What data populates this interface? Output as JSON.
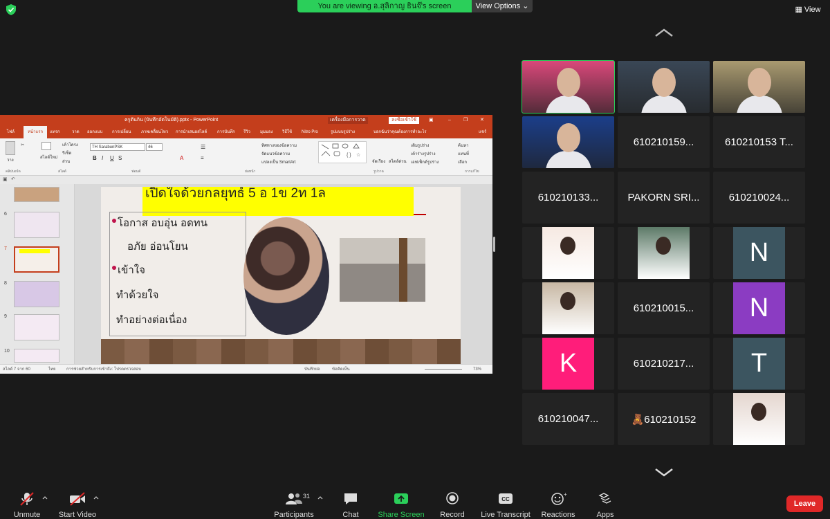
{
  "top_bar": {
    "banner_text": "You are viewing อ.สุลิกาญ ธินจ๊'s screen",
    "view_options_label": "View Options",
    "view_label": "View"
  },
  "ppt": {
    "window_title": "ครูต้นกิน (บันทึกอัตโนมัติ).pptx  -  PowerPoint",
    "tools_tag": "เครื่องมือการวาด",
    "login_label": "ลงชื่อเข้าใช้",
    "tabs": [
      "ไฟล์",
      "หน้าแรก",
      "แทรก",
      "วาด",
      "ออกแบบ",
      "การเปลี่ยน",
      "ภาพเคลื่อนไหว",
      "การนำเสนอสไลด์",
      "การบันทึก",
      "รีวิว",
      "มุมมอง",
      "วิธีใช้",
      "Nitro Pro",
      "รูปแบบรูปร่าง",
      "บอกฉันว่าคุณต้องการทำอะไร",
      "แชร์"
    ],
    "font_name": "TH SarabunPSK",
    "font_size": "46",
    "ribbon_groups": [
      "คลิปบอร์ด",
      "สไลด์",
      "ฟอนต์",
      "ย่อหน้า",
      "รูปวาด",
      "การแก้ไข"
    ],
    "ribbon_items": {
      "paste": "วาง",
      "new_slide": "สไลด์ใหม่",
      "layout": "เค้าโครง",
      "reset": "รีเซ็ต",
      "section": "ส่วน",
      "text_direction": "ทิศทางของข้อความ",
      "align_text": "จัดแนวข้อความ",
      "smartart": "แปลงเป็น SmartArt",
      "arrange": "จัดเรียง",
      "quick_styles": "สไตล์ด่วน",
      "shape_fill": "เติมรูปร่าง",
      "shape_outline": "เค้าร่างรูปร่าง",
      "shape_effects": "เอฟเฟ็กต์รูปร่าง",
      "find": "ค้นหา",
      "replace": "แทนที่",
      "select": "เลือก"
    },
    "thumb_numbers": [
      "6",
      "7",
      "8",
      "9",
      "10"
    ],
    "slide": {
      "title": "เปิดใจด้วยกลยุทธ์  5 อ 1ข 2ท 1ล",
      "lines": [
        "โอกาส  อบอุ่น  อดทน",
        "อภัย  อ่อนโยน",
        "เข้าใจ",
        "ทำด้วยใจ",
        "ทำอย่างต่อเนื่อง"
      ]
    },
    "status": {
      "slide_count": "สไลด์ 7 จาก 60",
      "language": "ไทย",
      "accessibility": "การช่วยสำหรับการเข้าถึง: โปรดตรวจสอบ",
      "notes": "บันทึกย่อ",
      "comments": "ข้อคิดเห็น",
      "zoom": "73%"
    }
  },
  "gallery": {
    "participants": [
      {
        "name": "",
        "kind": "video",
        "active": true,
        "bg": "#d9487a"
      },
      {
        "name": "",
        "kind": "video",
        "bg": "#3a4756"
      },
      {
        "name": "",
        "kind": "video",
        "bg": "#a99a70"
      },
      {
        "name": "",
        "kind": "video",
        "bg": "#1b3e8a"
      },
      {
        "name": "610210159...",
        "kind": "name"
      },
      {
        "name": "610210153 T...",
        "kind": "name"
      },
      {
        "name": "610210133...",
        "kind": "name"
      },
      {
        "name": "PAKORN SRI...",
        "kind": "name"
      },
      {
        "name": "610210024...",
        "kind": "name"
      },
      {
        "name": "",
        "kind": "picture",
        "bg": "#f6e9e2"
      },
      {
        "name": "",
        "kind": "picture",
        "bg": "#5d7a68"
      },
      {
        "name": "N",
        "kind": "avatar",
        "bg": "#3c5560"
      },
      {
        "name": "",
        "kind": "picture",
        "bg": "#c7b7a3"
      },
      {
        "name": "610210015...",
        "kind": "name"
      },
      {
        "name": "N",
        "kind": "avatar",
        "bg": "#8b3cc2"
      },
      {
        "name": "K",
        "kind": "avatar",
        "bg": "#ff1d7a"
      },
      {
        "name": "610210217...",
        "kind": "name"
      },
      {
        "name": "T",
        "kind": "avatar",
        "bg": "#3c5560"
      },
      {
        "name": "610210047...",
        "kind": "name"
      },
      {
        "name": "🧸610210152",
        "kind": "name"
      },
      {
        "name": "",
        "kind": "picture",
        "bg": "#e4d6cf"
      }
    ]
  },
  "toolbar": {
    "unmute": "Unmute",
    "start_video": "Start Video",
    "participants": "Participants",
    "participants_count": "31",
    "chat": "Chat",
    "share_screen": "Share Screen",
    "record": "Record",
    "live_transcript": "Live Transcript",
    "reactions": "Reactions",
    "apps": "Apps",
    "leave": "Leave",
    "cc_icon": "CC"
  },
  "colors": {
    "accent_green": "#2bcf5a",
    "ppt_red": "#c43e1c",
    "leave_red": "#e02828"
  }
}
